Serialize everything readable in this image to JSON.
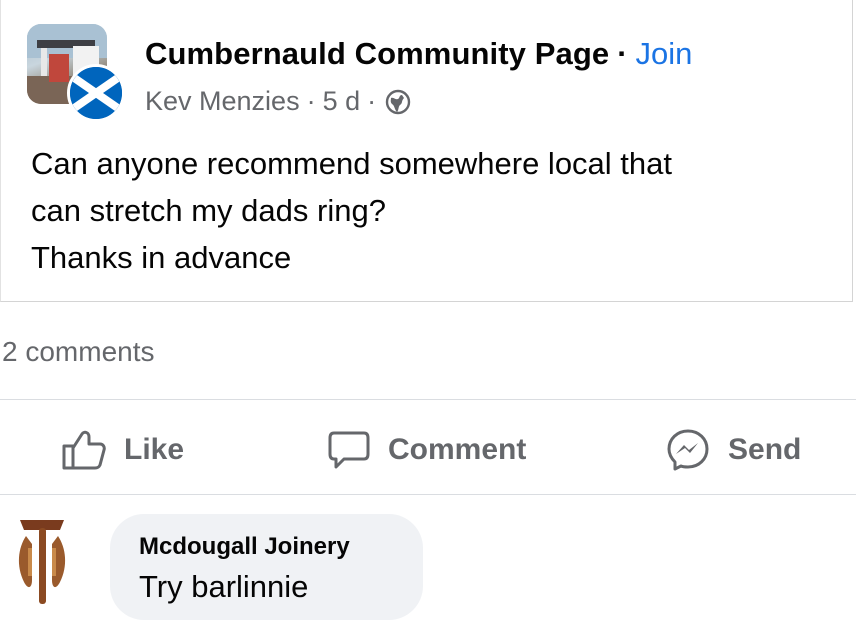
{
  "post": {
    "group_name": "Cumbernauld Community Page",
    "separator": "·",
    "join_label": "Join",
    "author": "Kev Menzies",
    "meta_dot": "·",
    "time": "5 d",
    "privacy_icon": "globe-icon",
    "body_lines": [
      "Can anyone recommend somewhere local that",
      "can stretch my dads ring?",
      "Thanks in advance"
    ]
  },
  "stats": {
    "comments_label": "2 comments"
  },
  "actions": {
    "like_label": "Like",
    "comment_label": "Comment",
    "send_label": "Send"
  },
  "comments": [
    {
      "author": "Mcdougall Joinery",
      "text": "Try barlinnie",
      "avatar_icon": "tools-logo-icon"
    }
  ],
  "colors": {
    "link_blue": "#1b74e4",
    "secondary_text": "#65676b",
    "bubble_bg": "#f0f2f5",
    "saltire_blue": "#0065bd"
  }
}
